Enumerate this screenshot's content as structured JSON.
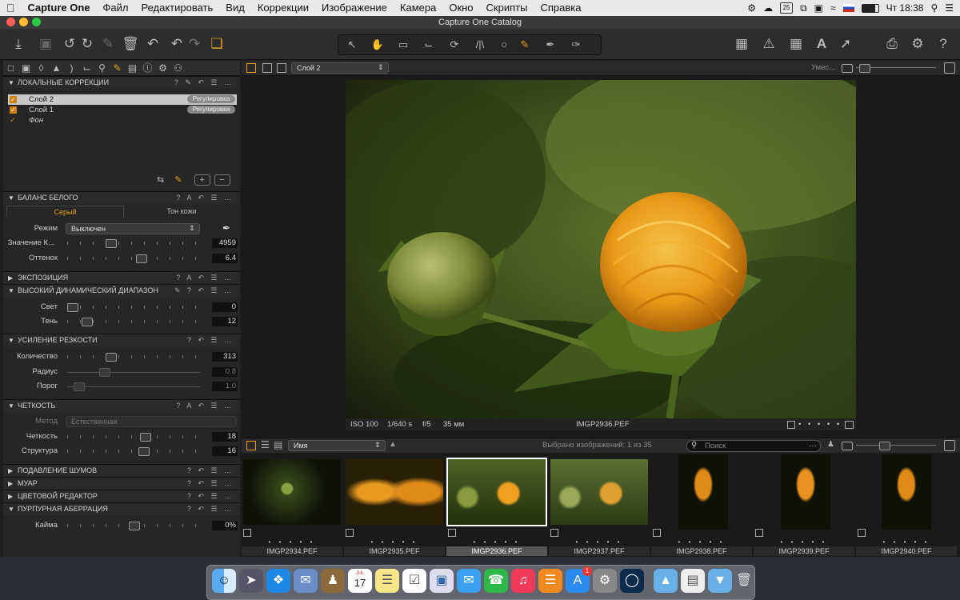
{
  "menubar": {
    "apple": "",
    "items": [
      "Capture One",
      "Файл",
      "Редактировать",
      "Вид",
      "Коррекции",
      "Изображение",
      "Камера",
      "Окно",
      "Скрипты",
      "Справка"
    ],
    "calendar_day": "25",
    "clock": "Чт 18:38"
  },
  "window": {
    "title": "Capture One Catalog"
  },
  "left_panel": {
    "local_adjustments": {
      "title": "ЛОКАЛЬНЫЕ КОРРЕКЦИИ",
      "layers": [
        {
          "name": "Слой 2",
          "badge": "Регулировка",
          "selected": true
        },
        {
          "name": "Слой 1",
          "badge": "Регулировка",
          "selected": false
        },
        {
          "name": "Фон",
          "badge": "",
          "selected": false
        }
      ]
    },
    "white_balance": {
      "title": "БАЛАНС БЕЛОГО",
      "tab_gray": "Серый",
      "tab_skin": "Тон кожи",
      "mode_label": "Режим",
      "mode_value": "Выключен",
      "kelvin_label": "Значение К...",
      "kelvin_value": "4959",
      "kelvin_pos": 0.31,
      "tint_label": "Оттенок",
      "tint_value": "6.4",
      "tint_pos": 0.56
    },
    "exposure": {
      "title": "ЭКСПОЗИЦИЯ"
    },
    "hdr": {
      "title": "ВЫСОКИЙ ДИНАМИЧЕСКИЙ ДИАПАЗОН",
      "highlight_label": "Свет",
      "highlight_value": "0",
      "highlight_pos": 0.0,
      "shadow_label": "Тень",
      "shadow_value": "12",
      "shadow_pos": 0.12
    },
    "sharpening": {
      "title": "УСИЛЕНИЕ РЕЗКОСТИ",
      "amount_label": "Количество",
      "amount_value": "313",
      "amount_pos": 0.31,
      "radius_label": "Радиус",
      "radius_value": "0.8",
      "radius_pos": 0.26,
      "threshold_label": "Порог",
      "threshold_value": "1.0",
      "threshold_pos": 0.05
    },
    "clarity": {
      "title": "ЧЕТКОСТЬ",
      "method_label": "Метод",
      "method_value": "Естественная",
      "clarity_label": "Четкость",
      "clarity_value": "18",
      "clarity_pos": 0.59,
      "structure_label": "Структура",
      "structure_value": "16",
      "structure_pos": 0.58
    },
    "noise": {
      "title": "ПОДАВЛЕНИЕ ШУМОВ"
    },
    "moire": {
      "title": "МУАР"
    },
    "color_editor": {
      "title": "ЦВЕТОВОЙ РЕДАКТОР"
    },
    "purple_fringe": {
      "title": "ПУРПУРНАЯ АБЕРРАЦИЯ",
      "amount_label": "Кайма",
      "amount_value": "0%",
      "amount_pos": 0.5
    }
  },
  "viewer": {
    "layer_select": "Слой 2",
    "fit_label": "Умес...",
    "zoom_pos": 0.05,
    "info_iso": "ISO 100",
    "info_shutter": "1/640 s",
    "info_aperture": "f/5",
    "info_focal": "35 мм",
    "info_filename": "IMGP2936.PEF"
  },
  "browser": {
    "sort_label": "Имя",
    "selected_count": "Выбрано изображений: 1 из 35",
    "search_placeholder": "Поиск",
    "thumb_size_pos": 0.33,
    "thumbnails": [
      {
        "name": "IMGP2934.PEF"
      },
      {
        "name": "IMGP2935.PEF"
      },
      {
        "name": "IMGP2936.PEF"
      },
      {
        "name": "IMGP2937.PEF"
      },
      {
        "name": "IMGP2938.PEF"
      },
      {
        "name": "IMGP2939.PEF"
      },
      {
        "name": "IMGP2940.PEF"
      }
    ],
    "stars": "• • • • •"
  },
  "dock": {
    "calendar_day": "17",
    "calendar_month": "JUL",
    "appstore_badge": "1"
  }
}
